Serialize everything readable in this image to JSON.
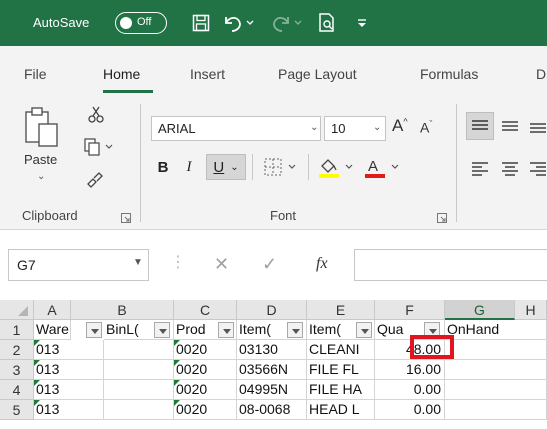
{
  "titlebar": {
    "autosave_label": "AutoSave",
    "toggle_state": "Off"
  },
  "tabs": [
    "File",
    "Home",
    "Insert",
    "Page Layout",
    "Formulas",
    "D"
  ],
  "ribbon": {
    "paste_label": "Paste",
    "font_name": "ARIAL",
    "font_size": "10",
    "groups": {
      "clipboard": "Clipboard",
      "font": "Font"
    }
  },
  "formula_bar": {
    "name_box": "G7",
    "fx": "fx"
  },
  "grid": {
    "columns": [
      "A",
      "B",
      "C",
      "D",
      "E",
      "F",
      "G",
      "H"
    ],
    "rows": [
      "1",
      "2",
      "3",
      "4",
      "5"
    ],
    "headers": [
      "Ware",
      "BinL(",
      "Prod",
      "Item(",
      "Item(",
      "Qua",
      "OnHand"
    ],
    "data": [
      [
        "013",
        "",
        "0020",
        "03130",
        "CLEANI",
        "48.00"
      ],
      [
        "013",
        "",
        "0020",
        "03566N",
        "FILE FL",
        "16.00"
      ],
      [
        "013",
        "",
        "0020",
        "04995N",
        "FILE HA",
        "0.00"
      ],
      [
        "013",
        "",
        "0020",
        "08-0068",
        "HEAD L",
        "0.00"
      ]
    ]
  },
  "colors": {
    "accent": "#217346",
    "highlight": "#e0151f"
  }
}
